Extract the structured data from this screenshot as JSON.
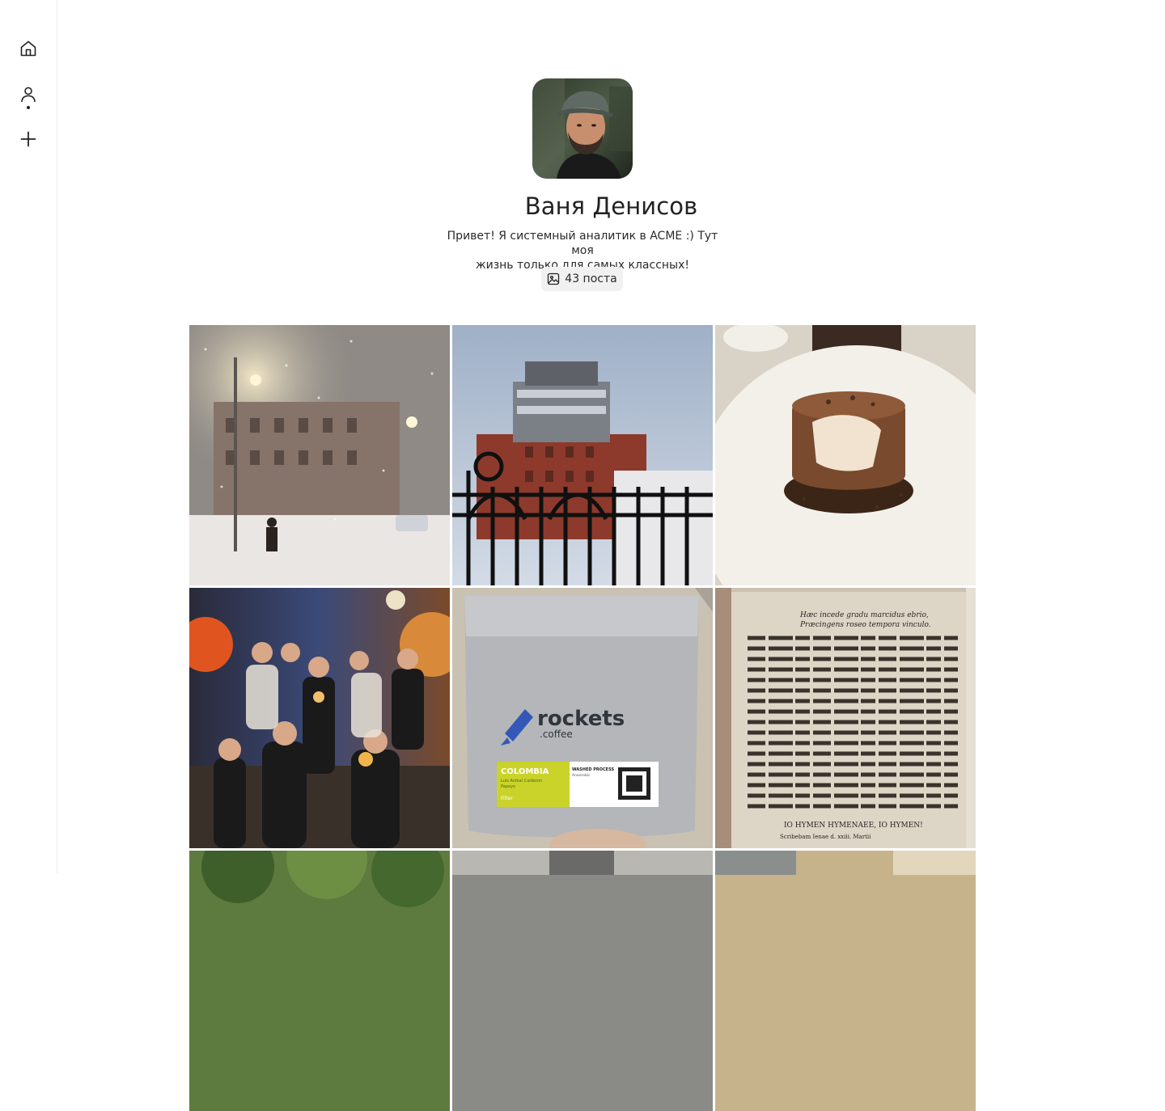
{
  "sidebar": {
    "items": [
      {
        "name": "home",
        "icon": "home-icon"
      },
      {
        "name": "profile",
        "icon": "user-icon",
        "active": true
      },
      {
        "name": "create",
        "icon": "plus-icon"
      }
    ]
  },
  "profile": {
    "name": "Ваня Денисов",
    "bio_line1": "Привет! Я системный аналитик в ACME :) Тут моя",
    "bio_line2": "жизнь только для самых классных!",
    "posts_count_label": "43 поста"
  },
  "grid": {
    "coffee_bag": {
      "brand": "rockets",
      "brand_suffix": ".coffee",
      "origin": "COLOMBIA",
      "producer": "Luis Anibal Calderon",
      "variety": "Papayo",
      "process": "WASHED PROCESS",
      "method": "Filter",
      "note": "Anaerobic"
    },
    "book_page": {
      "header": "Hæc incede gradu marcidus ebrio,",
      "header2": "Præcingens roseo tempora vinculo.",
      "footer": "IO HYMEN HYMENAEE, IO HYMEN!",
      "running": "Scribebam Ienae d. xxiii. Martii"
    }
  },
  "colors": {
    "sidebar_border": "#ececec",
    "badge_bg": "#f1f1f1",
    "text_primary": "#222222"
  }
}
